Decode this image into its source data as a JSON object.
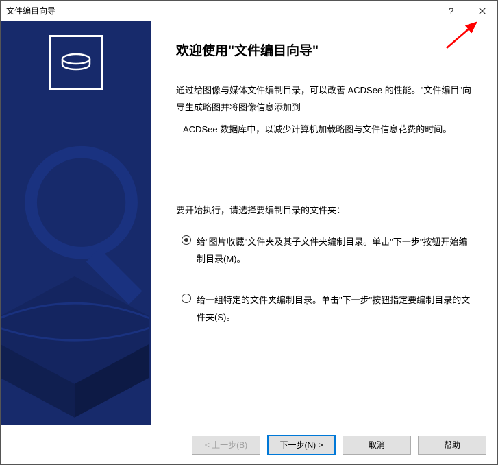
{
  "titlebar": {
    "title": "文件编目向导"
  },
  "main": {
    "heading": "欢迎使用\"文件编目向导\"",
    "para1": "通过给图像与媒体文件编制目录，可以改善 ACDSee 的性能。\"文件编目\"向导生成略图并将图像信息添加到",
    "para2": "ACDSee  数据库中，以减少计算机加载略图与文件信息花费的时间。",
    "prompt": "要开始执行，请选择要编制目录的文件夹：",
    "option1": "给\"图片收藏\"文件夹及其子文件夹编制目录。单击\"下一步\"按钮开始编制目录(M)。",
    "option2": "给一组特定的文件夹编制目录。单击\"下一步\"按钮指定要编制目录的文件夹(S)。"
  },
  "buttons": {
    "back": "< 上一步(B)",
    "next": "下一步(N) >",
    "cancel": "取消",
    "help": "帮助"
  }
}
